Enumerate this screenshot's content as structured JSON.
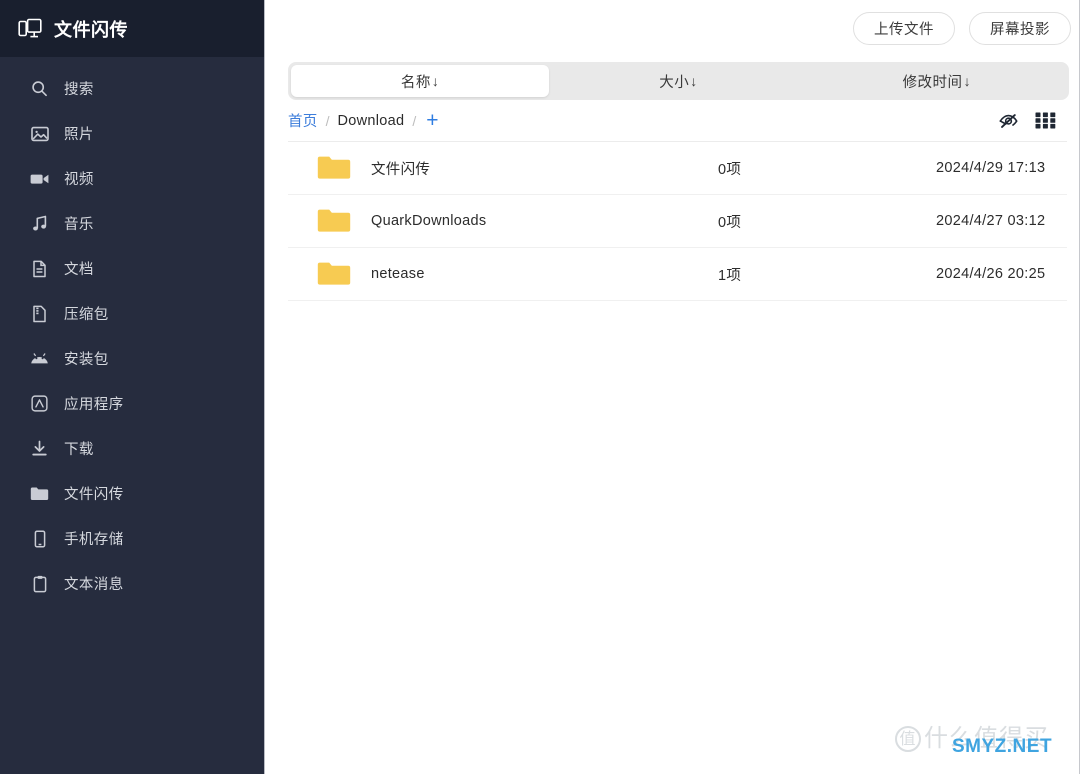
{
  "app": {
    "title": "文件闪传",
    "logo_icon": "cast-device-icon"
  },
  "sidebar": {
    "items": [
      {
        "label": "搜索",
        "icon": "search-icon"
      },
      {
        "label": "照片",
        "icon": "photo-icon"
      },
      {
        "label": "视频",
        "icon": "video-camera-icon"
      },
      {
        "label": "音乐",
        "icon": "music-note-icon"
      },
      {
        "label": "文档",
        "icon": "document-icon"
      },
      {
        "label": "压缩包",
        "icon": "archive-zip-icon"
      },
      {
        "label": "安装包",
        "icon": "android-apk-icon"
      },
      {
        "label": "应用程序",
        "icon": "app-store-icon"
      },
      {
        "label": "下载",
        "icon": "download-icon"
      },
      {
        "label": "文件闪传",
        "icon": "folder-icon"
      },
      {
        "label": "手机存储",
        "icon": "phone-icon"
      },
      {
        "label": "文本消息",
        "icon": "clipboard-icon"
      }
    ]
  },
  "topbar": {
    "upload_label": "上传文件",
    "cast_label": "屏幕投影"
  },
  "sort": {
    "options": [
      {
        "label": "名称",
        "arrow": "↓",
        "active": true
      },
      {
        "label": "大小",
        "arrow": "↓",
        "active": false
      },
      {
        "label": "修改时间",
        "arrow": "↓",
        "active": false
      }
    ]
  },
  "breadcrumb": {
    "home": "首页",
    "sep": "/",
    "current": "Download",
    "add": "+",
    "actions": [
      {
        "name": "hidden-files-icon",
        "icon": "eye-off-icon"
      },
      {
        "name": "grid-view-icon",
        "icon": "grid-icon"
      }
    ]
  },
  "files": {
    "rows": [
      {
        "name": "文件闪传",
        "size": "0项",
        "modified": "2024/4/29 17:13",
        "icon": "folder-icon"
      },
      {
        "name": "QuarkDownloads",
        "size": "0项",
        "modified": "2024/4/27 03:12",
        "icon": "folder-icon"
      },
      {
        "name": "netease",
        "size": "1项",
        "modified": "2024/4/26 20:25",
        "icon": "folder-icon"
      }
    ]
  },
  "watermark": {
    "badge": "值",
    "text": "什么值得买",
    "site": "SMYZ.NET"
  },
  "colors": {
    "sidebar_bg": "#262C3E",
    "sidebar_header_bg": "#191F2E",
    "accent_link": "#3C7DDB",
    "folder": "#F7CB52",
    "segment_track": "#E9E9E9",
    "watermark_site": "#3FA4E0"
  }
}
